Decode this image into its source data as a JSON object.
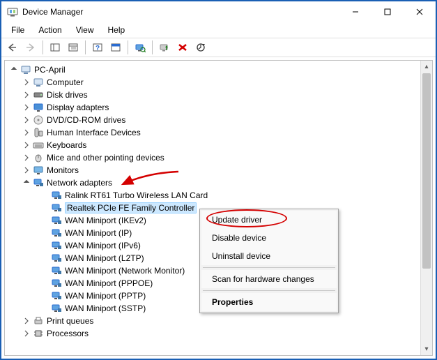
{
  "window": {
    "title": "Device Manager"
  },
  "menubar": [
    "File",
    "Action",
    "View",
    "Help"
  ],
  "root": {
    "label": "PC-April"
  },
  "categories": {
    "computer": "Computer",
    "disk_drives": "Disk drives",
    "display_adapters": "Display adapters",
    "dvd": "DVD/CD-ROM drives",
    "hid": "Human Interface Devices",
    "keyboards": "Keyboards",
    "mice": "Mice and other pointing devices",
    "monitors": "Monitors",
    "network_adapters": "Network adapters",
    "print_queues": "Print queues",
    "processors": "Processors"
  },
  "network_children": [
    "Ralink RT61 Turbo Wireless LAN Card",
    "Realtek PCIe FE Family Controller",
    "WAN Miniport (IKEv2)",
    "WAN Miniport (IP)",
    "WAN Miniport (IPv6)",
    "WAN Miniport (L2TP)",
    "WAN Miniport (Network Monitor)",
    "WAN Miniport (PPPOE)",
    "WAN Miniport (PPTP)",
    "WAN Miniport (SSTP)"
  ],
  "network_children_labels": {
    "0": "Ralink RT61 Turbo Wireless LAN Card",
    "1": "Realtek PCIe FE Family Controller",
    "2": "WAN Miniport (IKEv2)",
    "3": "WAN Miniport (IP)",
    "4": "WAN Miniport (IPv6)",
    "5": "WAN Miniport (L2TP)",
    "6": "WAN Miniport (Network Monitor)",
    "7": "WAN Miniport (PPPOE)",
    "8": "WAN Miniport (PPTP)",
    "9": "WAN Miniport (SSTP)"
  },
  "context_menu": {
    "update_driver": "Update driver",
    "disable_device": "Disable device",
    "uninstall_device": "Uninstall device",
    "scan": "Scan for hardware changes",
    "properties": "Properties"
  },
  "selected_device_index": 1,
  "annotations": {
    "arrow_target": "Network adapters",
    "oval_target": "Update driver"
  }
}
